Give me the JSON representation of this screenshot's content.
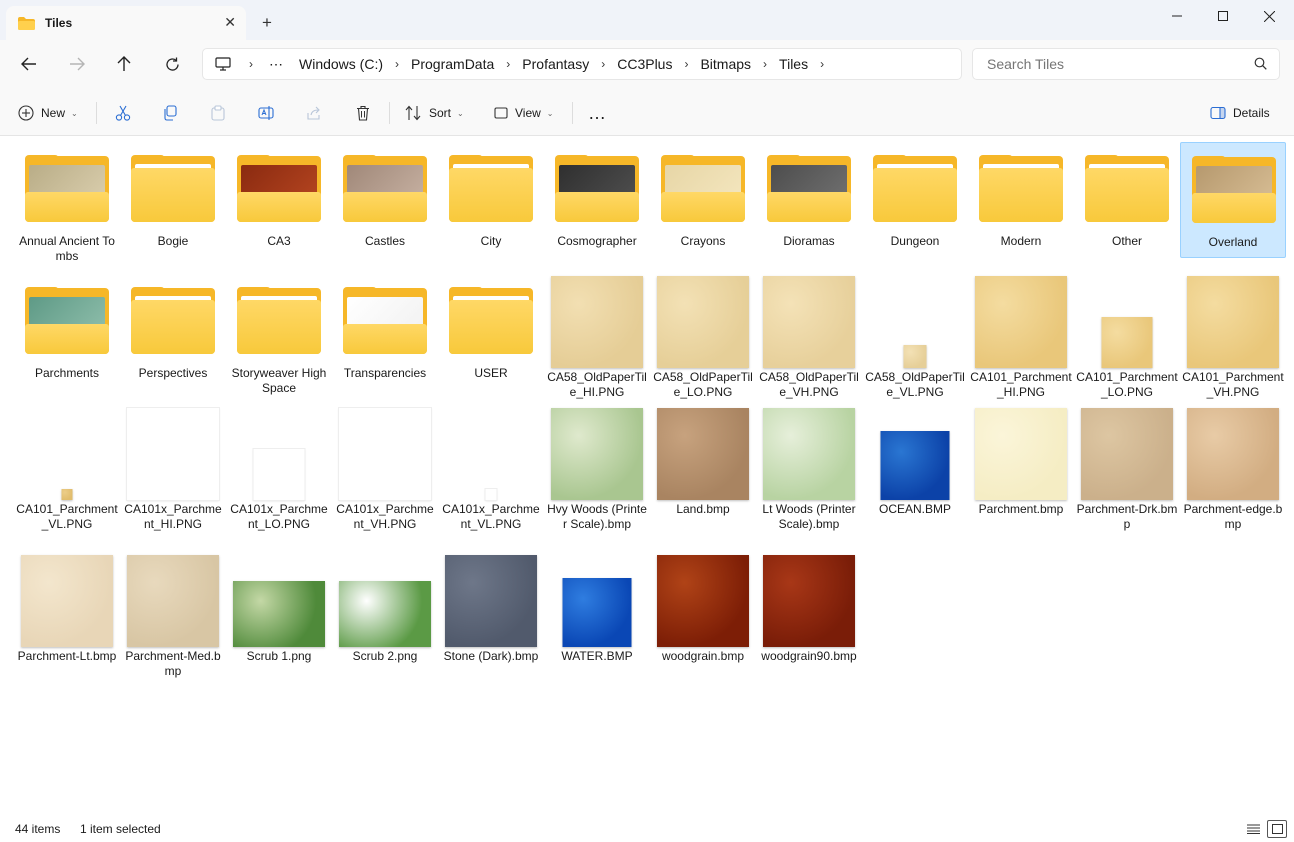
{
  "window": {
    "tab_title": "Tiles",
    "new_tab": "+",
    "minimize": "—",
    "maximize": "▢",
    "close": "✕"
  },
  "address": {
    "crumbs": [
      "Windows (C:)",
      "ProgramData",
      "Profantasy",
      "CC3Plus",
      "Bitmaps",
      "Tiles"
    ],
    "search_placeholder": "Search Tiles"
  },
  "toolbar": {
    "new_label": "New",
    "sort_label": "Sort",
    "view_label": "View",
    "more_label": "…",
    "details_label": "Details"
  },
  "items": [
    {
      "name": "Annual Ancient Tombs",
      "kind": "folder",
      "colors": [
        "#b9ad87",
        "#d8ccab"
      ]
    },
    {
      "name": "Bogie",
      "kind": "folder"
    },
    {
      "name": "CA3",
      "kind": "folder",
      "colors": [
        "#8a2a10",
        "#b2431f"
      ]
    },
    {
      "name": "Castles",
      "kind": "folder",
      "colors": [
        "#a08879",
        "#c4ae9f"
      ]
    },
    {
      "name": "City",
      "kind": "folder"
    },
    {
      "name": "Cosmographer",
      "kind": "folder",
      "colors": [
        "#2f2f2f",
        "#4d4d4d"
      ]
    },
    {
      "name": "Crayons",
      "kind": "folder",
      "colors": [
        "#e7d6a6",
        "#f3e5bd"
      ]
    },
    {
      "name": "Dioramas",
      "kind": "folder",
      "colors": [
        "#4d4d4d",
        "#6e6e6e"
      ]
    },
    {
      "name": "Dungeon",
      "kind": "folder"
    },
    {
      "name": "Modern",
      "kind": "folder"
    },
    {
      "name": "Other",
      "kind": "folder"
    },
    {
      "name": "Overland",
      "kind": "folder",
      "selected": true,
      "colors": [
        "#b6996e",
        "#d5bb92"
      ]
    },
    {
      "name": "Parchments",
      "kind": "folder",
      "colors": [
        "#5e9a86",
        "#8cbca9"
      ]
    },
    {
      "name": "Perspectives",
      "kind": "folder"
    },
    {
      "name": "Storyweaver HighSpace",
      "kind": "folder"
    },
    {
      "name": "Transparencies",
      "kind": "folder",
      "colors": [
        "#ffffff",
        "#f2f2f2"
      ]
    },
    {
      "name": "USER",
      "kind": "folder"
    },
    {
      "name": "CA58_OldPaperTile_HI.PNG",
      "kind": "image",
      "size": 1.0,
      "colors": [
        "#e5cd96",
        "#f2dfb2"
      ]
    },
    {
      "name": "CA58_OldPaperTile_LO.PNG",
      "kind": "image",
      "size": 1.0,
      "colors": [
        "#e6cf98",
        "#f3e1b5"
      ]
    },
    {
      "name": "CA58_OldPaperTile_VH.PNG",
      "kind": "image",
      "size": 1.0,
      "colors": [
        "#e7d09b",
        "#f4e2b7"
      ]
    },
    {
      "name": "CA58_OldPaperTile_VL.PNG",
      "kind": "image",
      "size": 0.25,
      "colors": [
        "#e6cf98",
        "#f3e1b5"
      ]
    },
    {
      "name": "CA101_Parchment_HI.PNG",
      "kind": "image",
      "size": 1.0,
      "colors": [
        "#e9c77a",
        "#f4dca0"
      ]
    },
    {
      "name": "CA101_Parchment_LO.PNG",
      "kind": "image",
      "size": 0.55,
      "colors": [
        "#e9c77a",
        "#f4dca0"
      ]
    },
    {
      "name": "CA101_Parchment_VH.PNG",
      "kind": "image",
      "size": 1.0,
      "colors": [
        "#e9c77a",
        "#f4dca0"
      ]
    },
    {
      "name": "CA101_Parchment_VL.PNG",
      "kind": "image",
      "size": 0.12,
      "colors": [
        "#e1bd6d",
        "#eccd88"
      ]
    },
    {
      "name": "CA101x_Parchment_HI.PNG",
      "kind": "image",
      "size": 1.0,
      "colors": [
        "#ffffff",
        "#ffffff"
      ]
    },
    {
      "name": "CA101x_Parchment_LO.PNG",
      "kind": "image",
      "size": 0.55,
      "colors": [
        "#ffffff",
        "#ffffff"
      ]
    },
    {
      "name": "CA101x_Parchment_VH.PNG",
      "kind": "image",
      "size": 1.0,
      "colors": [
        "#ffffff",
        "#ffffff"
      ]
    },
    {
      "name": "CA101x_Parchment_VL.PNG",
      "kind": "image",
      "size": 0.12,
      "colors": [
        "#ffffff",
        "#ffffff"
      ]
    },
    {
      "name": "Hvy Woods (Printer Scale).bmp",
      "kind": "image",
      "size": 1.0,
      "colors": [
        "#a9c690",
        "#dfe9cd"
      ]
    },
    {
      "name": "Land.bmp",
      "kind": "image",
      "size": 1.0,
      "colors": [
        "#a98461",
        "#c7a27e"
      ]
    },
    {
      "name": "Lt Woods (Printer Scale).bmp",
      "kind": "image",
      "size": 1.0,
      "colors": [
        "#b8d3a2",
        "#e6efda"
      ]
    },
    {
      "name": "OCEAN.BMP",
      "kind": "image",
      "size": 0.75,
      "colors": [
        "#0c42a8",
        "#2a76d2"
      ]
    },
    {
      "name": "Parchment.bmp",
      "kind": "image",
      "size": 1.0,
      "colors": [
        "#f5edc4",
        "#fbf5d9"
      ]
    },
    {
      "name": "Parchment-Drk.bmp",
      "kind": "image",
      "size": 1.0,
      "colors": [
        "#cbb08b",
        "#ddc6a2"
      ]
    },
    {
      "name": "Parchment-edge.bmp",
      "kind": "image",
      "size": 1.0,
      "colors": [
        "#d2ad82",
        "#e8cba6"
      ]
    },
    {
      "name": "Parchment-Lt.bmp",
      "kind": "image",
      "size": 1.0,
      "colors": [
        "#e8d6b7",
        "#f3e6cd"
      ]
    },
    {
      "name": "Parchment-Med.bmp",
      "kind": "image",
      "size": 1.0,
      "colors": [
        "#d8c6a4",
        "#e8d9bd"
      ]
    },
    {
      "name": "Scrub 1.png",
      "kind": "image",
      "size": 1.0,
      "shape": "wide",
      "colors": [
        "#4f8a3a",
        "#c4d8a6"
      ]
    },
    {
      "name": "Scrub 2.png",
      "kind": "image",
      "size": 1.0,
      "shape": "wide",
      "colors": [
        "#5b9a45",
        "#ffffff"
      ]
    },
    {
      "name": "Stone (Dark).bmp",
      "kind": "image",
      "size": 1.0,
      "colors": [
        "#515a6c",
        "#6e7789"
      ]
    },
    {
      "name": "WATER.BMP",
      "kind": "image",
      "size": 0.75,
      "colors": [
        "#0a47b5",
        "#2f7de0"
      ]
    },
    {
      "name": "woodgrain.bmp",
      "kind": "image",
      "size": 1.0,
      "colors": [
        "#7d1e06",
        "#b04317"
      ]
    },
    {
      "name": "woodgrain90.bmp",
      "kind": "image",
      "size": 1.0,
      "colors": [
        "#7a1d08",
        "#a83717"
      ]
    }
  ],
  "status": {
    "count": "44 items",
    "selection": "1 item selected"
  }
}
